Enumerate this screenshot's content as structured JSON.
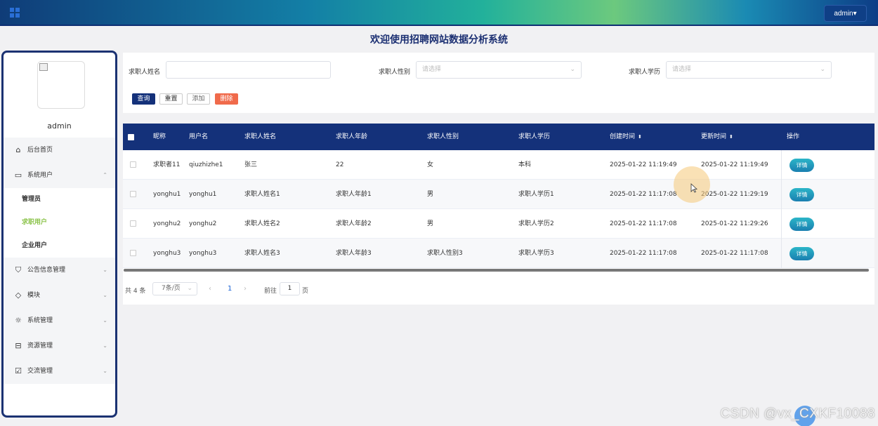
{
  "header": {
    "admin_label": "admin",
    "admin_caret": "▾"
  },
  "page_title": "欢迎使用招聘网站数据分析系统",
  "sidebar": {
    "username": "admin",
    "menu": [
      {
        "label": "后台首页",
        "icon": "home-icon"
      },
      {
        "label": "系统用户",
        "icon": "monitor-icon",
        "chevron": "⌃"
      }
    ],
    "submenu": [
      {
        "label": "管理员",
        "active": false
      },
      {
        "label": "求职用户",
        "active": true
      },
      {
        "label": "企业用户",
        "active": false
      }
    ],
    "menu2": [
      {
        "label": "公告信息管理",
        "icon": "bookmark-icon"
      },
      {
        "label": "模块",
        "icon": "tag-icon"
      },
      {
        "label": "系统管理",
        "icon": "sun-icon"
      },
      {
        "label": "资源管理",
        "icon": "inbox-icon"
      },
      {
        "label": "交流管理",
        "icon": "clipboard-icon"
      }
    ],
    "chevron_down": "⌄"
  },
  "filters": {
    "name_label": "求职人姓名",
    "name_value": "",
    "gender_label": "求职人性别",
    "gender_placeholder": "请选择",
    "edu_label": "求职人学历",
    "edu_placeholder": "请选择",
    "query": "查询",
    "reset": "重置",
    "add": "添加",
    "delete": "删除"
  },
  "table": {
    "headers": {
      "nickname": "昵称",
      "username": "用户名",
      "name": "求职人姓名",
      "age": "求职人年龄",
      "gender": "求职人性别",
      "edu": "求职人学历",
      "created": "创建时间",
      "updated": "更新时间",
      "ops": "操作",
      "sort_symbol": "⬍"
    },
    "detail_label": "详情",
    "rows": [
      {
        "nickname": "求职者11",
        "username": "qiuzhizhe1",
        "name": "张三",
        "age": "22",
        "gender": "女",
        "edu": "本科",
        "created": "2025-01-22 11:19:49",
        "updated": "2025-01-22 11:19:49"
      },
      {
        "nickname": "yonghu1",
        "username": "yonghu1",
        "name": "求职人姓名1",
        "age": "求职人年龄1",
        "gender": "男",
        "edu": "求职人学历1",
        "created": "2025-01-22 11:17:08",
        "updated": "2025-01-22 11:29:19"
      },
      {
        "nickname": "yonghu2",
        "username": "yonghu2",
        "name": "求职人姓名2",
        "age": "求职人年龄2",
        "gender": "男",
        "edu": "求职人学历2",
        "created": "2025-01-22 11:17:08",
        "updated": "2025-01-22 11:29:26"
      },
      {
        "nickname": "yonghu3",
        "username": "yonghu3",
        "name": "求职人姓名3",
        "age": "求职人年龄3",
        "gender": "求职人性别3",
        "edu": "求职人学历3",
        "created": "2025-01-22 11:17:08",
        "updated": "2025-01-22 11:17:08"
      }
    ]
  },
  "pagination": {
    "total": "共 4 条",
    "page_size": "7条/页",
    "prev": "‹",
    "current": "1",
    "next": "›",
    "goto_label": "前往",
    "goto_value": "1",
    "page_suffix": "页"
  },
  "watermark": "CSDN @vx_CXKF10088"
}
